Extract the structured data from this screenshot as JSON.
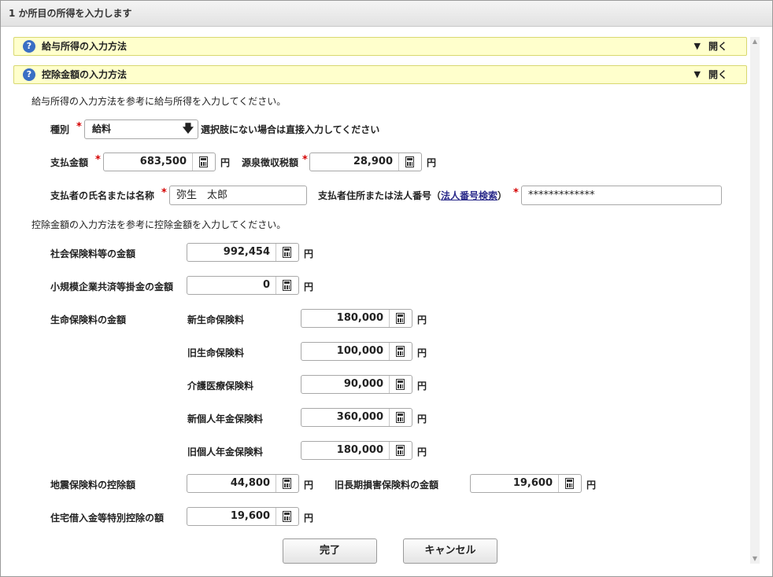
{
  "dialog": {
    "title": "1 か所目の所得を入力します"
  },
  "accordions": [
    {
      "label": "給与所得の入力方法",
      "toggle": "開く"
    },
    {
      "label": "控除金額の入力方法",
      "toggle": "開く"
    }
  ],
  "income": {
    "instruction": "給与所得の入力方法を参考に給与所得を入力してください。",
    "type_label": "種別",
    "type_value": "給料",
    "type_hint": "選択肢にない場合は直接入力してください",
    "payment_label": "支払金額",
    "payment_value": "683,500",
    "withholding_label": "源泉徴収税額",
    "withholding_value": "28,900",
    "payer_name_label": "支払者の氏名または名称",
    "payer_name_value": "弥生　太郎",
    "payer_address_label_prefix": "支払者住所または法人番号（",
    "payer_address_link": "法人番号検索",
    "payer_address_label_suffix": "）",
    "payer_address_value": "*************"
  },
  "deduction": {
    "instruction": "控除金額の入力方法を参考に控除金額を入力してください。",
    "social_insurance_label": "社会保険料等の金額",
    "social_insurance_value": "992,454",
    "small_business_label": "小規模企業共済等掛金の金額",
    "small_business_value": "0",
    "life_insurance_label": "生命保険料の金額",
    "life_items": [
      {
        "label": "新生命保険料",
        "value": "180,000"
      },
      {
        "label": "旧生命保険料",
        "value": "100,000"
      },
      {
        "label": "介護医療保険料",
        "value": "90,000"
      },
      {
        "label": "新個人年金保険料",
        "value": "360,000"
      },
      {
        "label": "旧個人年金保険料",
        "value": "180,000"
      }
    ],
    "earthquake_label": "地震保険料の控除額",
    "earthquake_value": "44,800",
    "old_longterm_label": "旧長期損害保険料の金額",
    "old_longterm_value": "19,600",
    "housing_loan_label": "住宅借入金等特別控除の額",
    "housing_loan_value": "19,600"
  },
  "required_mark": "*",
  "unit": "円",
  "icons": {
    "help": "?",
    "toggle": "▼",
    "dropdown": "🡇",
    "scroll_up": "▲",
    "scroll_down": "▼"
  },
  "buttons": {
    "ok": "完了",
    "cancel": "キャンセル"
  }
}
